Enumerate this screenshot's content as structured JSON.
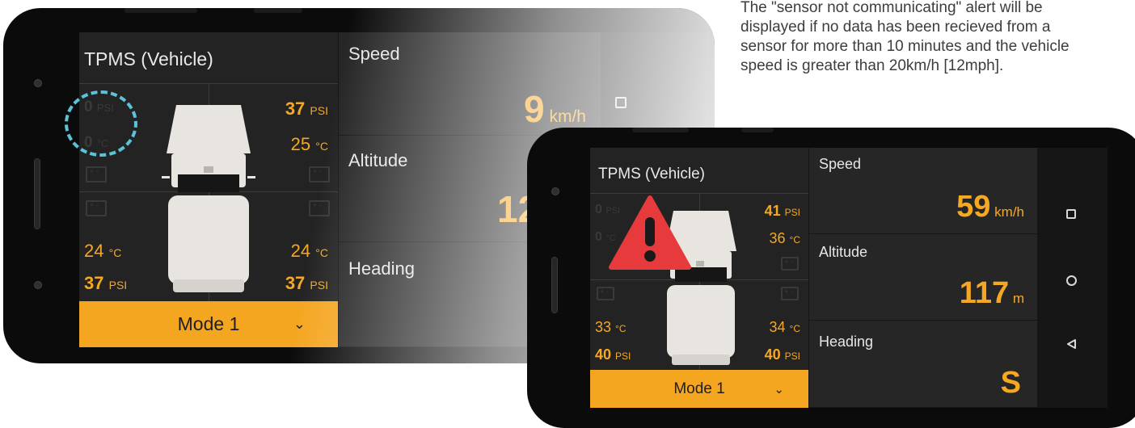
{
  "annotation": {
    "text": "The \"sensor not communicating\" alert will be displayed if no data has been recieved from a sensor for more than 10 minutes and the vehicle speed is greater than 20km/h [12mph]."
  },
  "back_phone": {
    "tpms_title": "TPMS (Vehicle)",
    "front_left": {
      "pressure": "0",
      "pressure_unit": "PSI",
      "temp": "0",
      "temp_unit": "°C"
    },
    "front_right": {
      "pressure": "37",
      "pressure_unit": "PSI",
      "temp": "25",
      "temp_unit": "°C"
    },
    "rear_left": {
      "pressure": "37",
      "pressure_unit": "PSI",
      "temp": "24",
      "temp_unit": "°C"
    },
    "rear_right": {
      "pressure": "37",
      "pressure_unit": "PSI",
      "temp": "24",
      "temp_unit": "°C"
    },
    "mode_label": "Mode 1",
    "speed_label": "Speed",
    "speed_value": "9",
    "speed_unit": "km/h",
    "altitude_label": "Altitude",
    "altitude_value": "12",
    "heading_label": "Heading"
  },
  "front_phone": {
    "tpms_title": "TPMS (Vehicle)",
    "front_left": {
      "pressure": "0",
      "pressure_unit": "PSI",
      "temp": "0",
      "temp_unit": "°C"
    },
    "front_right": {
      "pressure": "41",
      "pressure_unit": "PSI",
      "temp": "36",
      "temp_unit": "°C"
    },
    "rear_left": {
      "pressure": "40",
      "pressure_unit": "PSI",
      "temp": "33",
      "temp_unit": "°C"
    },
    "rear_right": {
      "pressure": "40",
      "pressure_unit": "PSI",
      "temp": "34",
      "temp_unit": "°C"
    },
    "mode_label": "Mode 1",
    "speed_label": "Speed",
    "speed_value": "59",
    "speed_unit": "km/h",
    "altitude_label": "Altitude",
    "altitude_value": "117",
    "altitude_unit": "m",
    "heading_label": "Heading",
    "heading_value": "S"
  },
  "nav_icons": [
    "square-icon",
    "circle-icon",
    "triangle-back-icon"
  ],
  "colors": {
    "accent": "#f7a823",
    "mode_bar": "#f4a621",
    "alert_red": "#e63a3c",
    "highlight_circle": "#5bc3d8",
    "screen_bg": "#1f1f1f"
  }
}
